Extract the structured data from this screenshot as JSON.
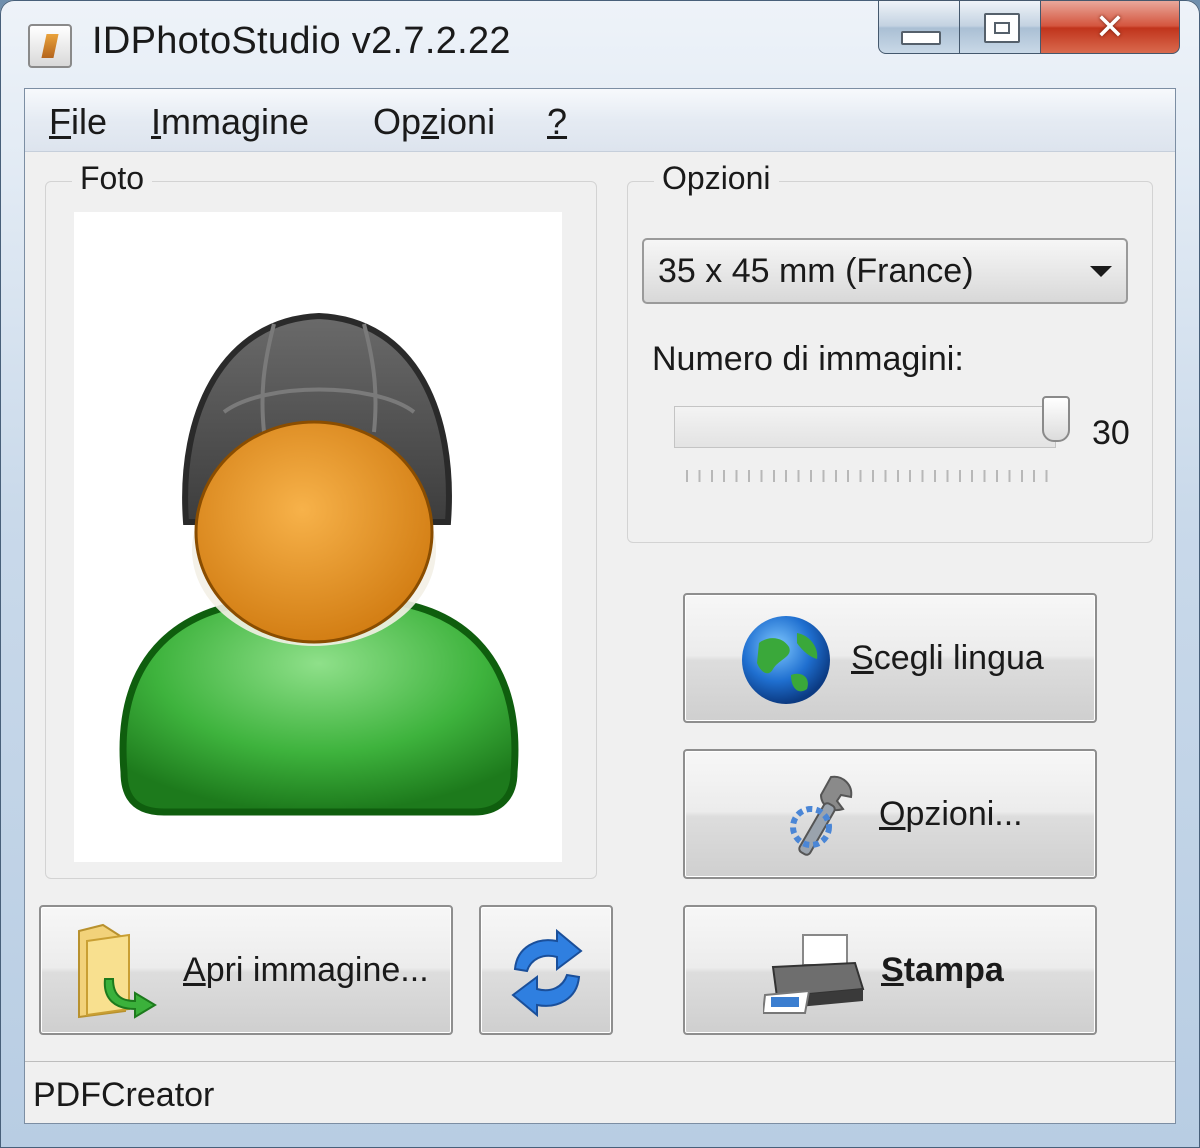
{
  "window": {
    "title": "IDPhotoStudio v2.7.2.22"
  },
  "menu": [
    {
      "pre": "",
      "key": "F",
      "post": "ile"
    },
    {
      "pre": "",
      "key": "I",
      "post": "mmagine"
    },
    {
      "pre": "Op",
      "key": "z",
      "post": "ioni"
    },
    {
      "pre": "",
      "key": "?",
      "post": ""
    }
  ],
  "photo_group": {
    "title": "Foto"
  },
  "options_group": {
    "title": "Opzioni",
    "format_selected": "35 x 45 mm (France)",
    "count_label": "Numero di immagini:",
    "count_value": "30"
  },
  "buttons": {
    "language": {
      "key": "S",
      "rest": "cegli lingua",
      "icon": "globe-icon"
    },
    "options": {
      "key": "O",
      "rest": "pzioni...",
      "icon": "tools-icon"
    },
    "print": {
      "key": "S",
      "rest": "tampa",
      "icon": "printer-icon"
    },
    "open": {
      "key": "A",
      "rest": "pri immagine...",
      "icon": "folder-icon"
    },
    "rotate": {
      "icon": "refresh-icon"
    }
  },
  "status": {
    "text": "PDFCreator"
  }
}
